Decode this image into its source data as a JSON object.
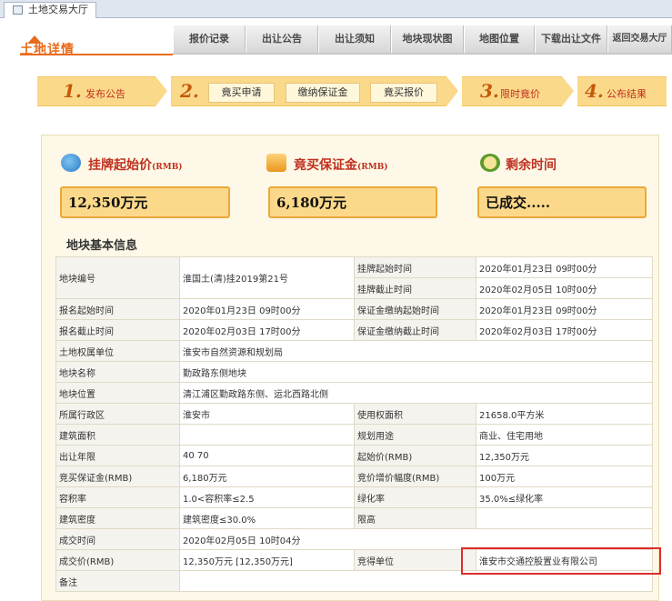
{
  "tab": {
    "title": "土地交易大厅"
  },
  "logo": {
    "text": "土地详情"
  },
  "nav": {
    "items": [
      {
        "label": "报价记录"
      },
      {
        "label": "出让公告"
      },
      {
        "label": "出让须知"
      },
      {
        "label": "地块现状图"
      },
      {
        "label": "地图位置"
      },
      {
        "label": "下载出让文件"
      },
      {
        "label": "返回交易大厅"
      }
    ]
  },
  "steps": {
    "s1": {
      "num": "1.",
      "label": "发布公告"
    },
    "s2": {
      "num": "2.",
      "buttons": [
        "竟买申请",
        "缴纳保证金",
        "竟买报价"
      ]
    },
    "s3": {
      "num": "3.",
      "label": "限时竟价"
    },
    "s4": {
      "num": "4.",
      "label": "公布结果"
    }
  },
  "stats": {
    "start_price": {
      "title": "挂牌起始价",
      "unit": "(RMB)",
      "value": "12,350万元"
    },
    "deposit": {
      "title": "竟买保证金",
      "unit": "(RMB)",
      "value": "6,180万元"
    },
    "remaining": {
      "title": "剩余时间",
      "value": "已成交....."
    }
  },
  "section": {
    "title": "地块基本信息"
  },
  "table": {
    "r1": {
      "l1": "地块编号",
      "v1": "淮国土(清)挂2019第21号",
      "l2": "挂牌起始时间",
      "v2": "2020年01月23日 09时00分"
    },
    "r2": {
      "l2": "挂牌截止时间",
      "v2": "2020年02月05日 10时00分"
    },
    "r3": {
      "l1": "报名起始时间",
      "v1": "2020年01月23日 09时00分",
      "l2": "保证金缴纳起始时间",
      "v2": "2020年01月23日 09时00分"
    },
    "r4": {
      "l1": "报名截止时间",
      "v1": "2020年02月03日 17时00分",
      "l2": "保证金缴纳截止时间",
      "v2": "2020年02月03日 17时00分"
    },
    "r5": {
      "l1": "土地权属单位",
      "v1": "淮安市自然资源和规划局"
    },
    "r6": {
      "l1": "地块名称",
      "v1": "勤政路东侧地块"
    },
    "r7": {
      "l1": "地块位置",
      "v1": "清江浦区勤政路东侧、运北西路北侧"
    },
    "r8": {
      "l1": "所属行政区",
      "v1": "淮安市",
      "l2": "使用权面积",
      "v2": "21658.0平方米"
    },
    "r9": {
      "l1": "建筑面积",
      "v1": "",
      "l2": "规划用途",
      "v2": "商业、住宅用地"
    },
    "r10": {
      "l1": "出让年限",
      "v1": "40 70",
      "l2": "起始价(RMB)",
      "v2": "12,350万元"
    },
    "r11": {
      "l1": "竞买保证金(RMB)",
      "v1": "6,180万元",
      "l2": "竞价增价幅度(RMB)",
      "v2": "100万元"
    },
    "r12": {
      "l1": "容积率",
      "v1": "1.0<容积率≤2.5",
      "l2": "绿化率",
      "v2": "35.0%≤绿化率"
    },
    "r13": {
      "l1": "建筑密度",
      "v1": "建筑密度≤30.0%",
      "l2": "限高",
      "v2": ""
    },
    "r14": {
      "l1": "成交时间",
      "v1": "2020年02月05日 10时04分"
    },
    "r15": {
      "l1": "成交价(RMB)",
      "v1": "12,350万元 [12,350万元]",
      "l2": "竞得单位",
      "v2": "淮安市交通控股置业有限公司"
    },
    "r16": {
      "l1": "备注",
      "v1": ""
    }
  },
  "colors": {
    "accent": "#e86b1a",
    "step_bg": "#fbd98a",
    "highlight": "#e12b2b"
  }
}
